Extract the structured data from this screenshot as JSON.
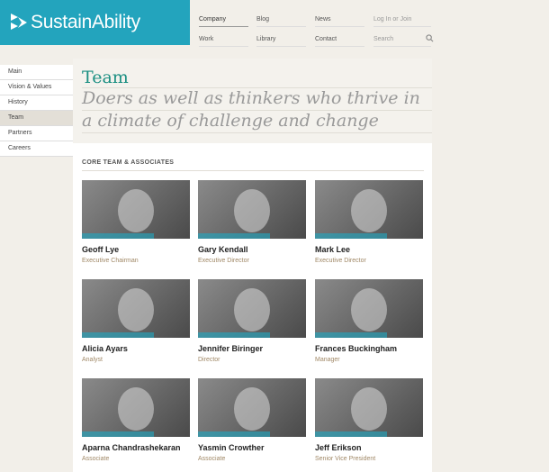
{
  "brand": {
    "name": "SustainAbility",
    "color": "#23a4bd"
  },
  "topnav": {
    "items": [
      "Company",
      "Blog",
      "News",
      "Log In or Join",
      "Work",
      "Library",
      "Contact"
    ],
    "search_placeholder": "Search"
  },
  "sidenav": {
    "items": [
      "Main",
      "Vision & Values",
      "History",
      "Team",
      "Partners",
      "Careers"
    ],
    "active": "Team"
  },
  "hero": {
    "title": "Team",
    "subtitle": "Doers as well as thinkers who thrive in a climate of challenge and change"
  },
  "section": {
    "title": "CORE TEAM & ASSOCIATES"
  },
  "team": [
    {
      "name": "Geoff Lye",
      "role": "Executive Chairman"
    },
    {
      "name": "Gary Kendall",
      "role": "Executive Director"
    },
    {
      "name": "Mark Lee",
      "role": "Executive Director"
    },
    {
      "name": "Alicia Ayars",
      "role": "Analyst"
    },
    {
      "name": "Jennifer Biringer",
      "role": "Director"
    },
    {
      "name": "Frances Buckingham",
      "role": "Manager"
    },
    {
      "name": "Aparna Chandrashekaran",
      "role": "Associate"
    },
    {
      "name": "Yasmin Crowther",
      "role": "Associate"
    },
    {
      "name": "Jeff Erikson",
      "role": "Senior Vice President"
    }
  ]
}
